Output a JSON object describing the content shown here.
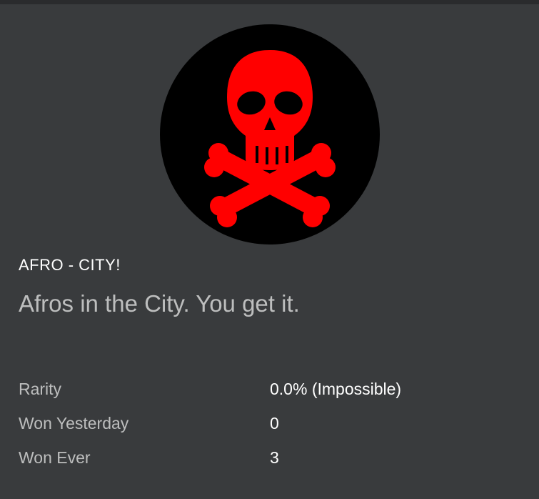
{
  "badge": {
    "image_icon": "skull-crossbones-icon",
    "name": "AFRO - CITY!",
    "description": "Afros in the City. You get it.",
    "colors": {
      "background": "#393b3d",
      "icon_circle": "#000000",
      "icon_symbol": "#ff0000"
    }
  },
  "stats": [
    {
      "label": "Rarity",
      "value": "0.0% (Impossible)"
    },
    {
      "label": "Won Yesterday",
      "value": "0"
    },
    {
      "label": "Won Ever",
      "value": "3"
    }
  ]
}
